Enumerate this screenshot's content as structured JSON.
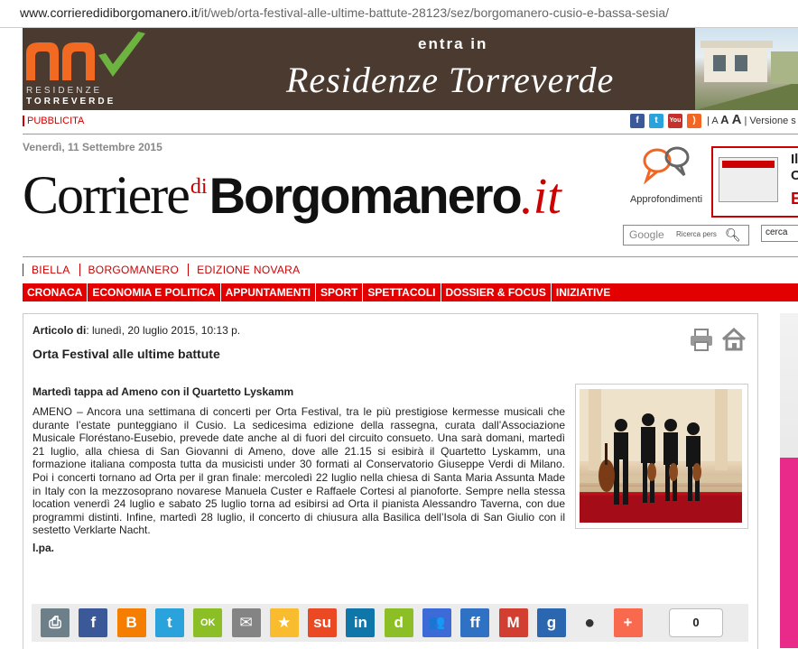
{
  "browser": {
    "url_host": "www.corrieredidiborgomanero.it",
    "url_path": "/it/web/orta-festival-alle-ultime-battute-28123/sez/borgomanero-cusio-e-bassa-sesia/"
  },
  "banner": {
    "tagline": "entra in",
    "brand": "Residenze Torreverde",
    "logo_line1": "RESIDENZE",
    "logo_line2": "TORREVERDE"
  },
  "topbar": {
    "pubblicita": "PUBBLICITA",
    "size_a1": "A",
    "size_a2": "A",
    "size_a3": "A",
    "versione": "Versione s"
  },
  "date": "Venerdì, 11 Settembre 2015",
  "masthead": {
    "part1": "Corriere",
    "di": "di",
    "part2": "Borgomanero",
    "suffix": ".it"
  },
  "approfondimenti": "Approfondimenti",
  "promo": {
    "t1": "Il",
    "t2": "C",
    "t3": "E"
  },
  "search": {
    "google": "Google",
    "ricerca": "Ricerca pers",
    "cerca": "cerca"
  },
  "nav_editions": [
    "BIELLA",
    "BORGOMANERO",
    "EDIZIONE NOVARA"
  ],
  "nav_sections": [
    "CRONACA",
    "ECONOMIA E POLITICA",
    "APPUNTAMENTI",
    "SPORT",
    "SPETTACOLI",
    "DOSSIER & FOCUS",
    "INIZIATIVE"
  ],
  "article": {
    "meta_label": "Articolo di",
    "meta_date": ": lunedì, 20 luglio 2015, 10:13 p.",
    "title": "Orta Festival alle ultime battute",
    "subtitle": "Martedì tappa ad Ameno con il Quartetto Lyskamm",
    "body": "AMENO – Ancora una settimana di concerti per Orta Festival, tra le più prestigiose kermesse musicali che durante l’estate punteggiano il Cusio. La sedicesima edizione della rassegna, curata dall’Associazione Musicale Floréstano-Eusebio, prevede date anche al di fuori del circuito consueto. Una sarà domani, martedì 21 luglio, alla chiesa di San Giovanni di Ameno, dove alle 21.15 si esibirà il Quartetto Lyskamm, una formazione italiana composta tutta da musicisti under 30 formati al Conservatorio Giuseppe Verdi di Milano. Poi i concerti tornano ad Orta per il gran finale: mercoledì 22 luglio nella chiesa di Santa Maria Assunta Made in Italy con la mezzosoprano novarese Manuela Custer e Raffaele Cortesi al pianoforte. Sempre nella stessa location venerdì 24 luglio e sabato 25 luglio torna ad esibirsi ad Orta il pianista Alessandro Taverna, con due programmi distinti. Infine, martedì 28 luglio, il concerto di chiusura alla Basilica dell’Isola di San Giulio con il sestetto Verklarte Nacht.",
    "author": "l.pa."
  },
  "share": {
    "count": "0",
    "buttons": [
      {
        "name": "print",
        "glyph": "⎙",
        "color": "#6d7f89"
      },
      {
        "name": "facebook",
        "glyph": "f",
        "color": "#3b5998"
      },
      {
        "name": "blogger",
        "glyph": "B",
        "color": "#f57d00"
      },
      {
        "name": "twitter",
        "glyph": "t",
        "color": "#2aa3dc"
      },
      {
        "name": "oknotizie",
        "glyph": "OK",
        "color": "#8cbf26"
      },
      {
        "name": "email",
        "glyph": "✉",
        "color": "#848484"
      },
      {
        "name": "favorites",
        "glyph": "★",
        "color": "#f8bc2e"
      },
      {
        "name": "stumbleupon",
        "glyph": "su",
        "color": "#eb4924"
      },
      {
        "name": "linkedin",
        "glyph": "in",
        "color": "#0e76a8"
      },
      {
        "name": "diigo",
        "glyph": "d",
        "color": "#8cbf26"
      },
      {
        "name": "myspace",
        "glyph": "👥",
        "color": "#3c6ad7"
      },
      {
        "name": "friendfeed",
        "glyph": "ff",
        "color": "#2f72c4"
      },
      {
        "name": "gmail",
        "glyph": "M",
        "color": "#d23f31"
      },
      {
        "name": "google",
        "glyph": "g",
        "color": "#2a67b0"
      },
      {
        "name": "reddit",
        "glyph": "●",
        "color": "#ececec"
      },
      {
        "name": "more",
        "glyph": "+",
        "color": "#f8694d"
      }
    ]
  },
  "colors": {
    "accent": "#e30000",
    "banner_bg": "#4a3a2f"
  }
}
